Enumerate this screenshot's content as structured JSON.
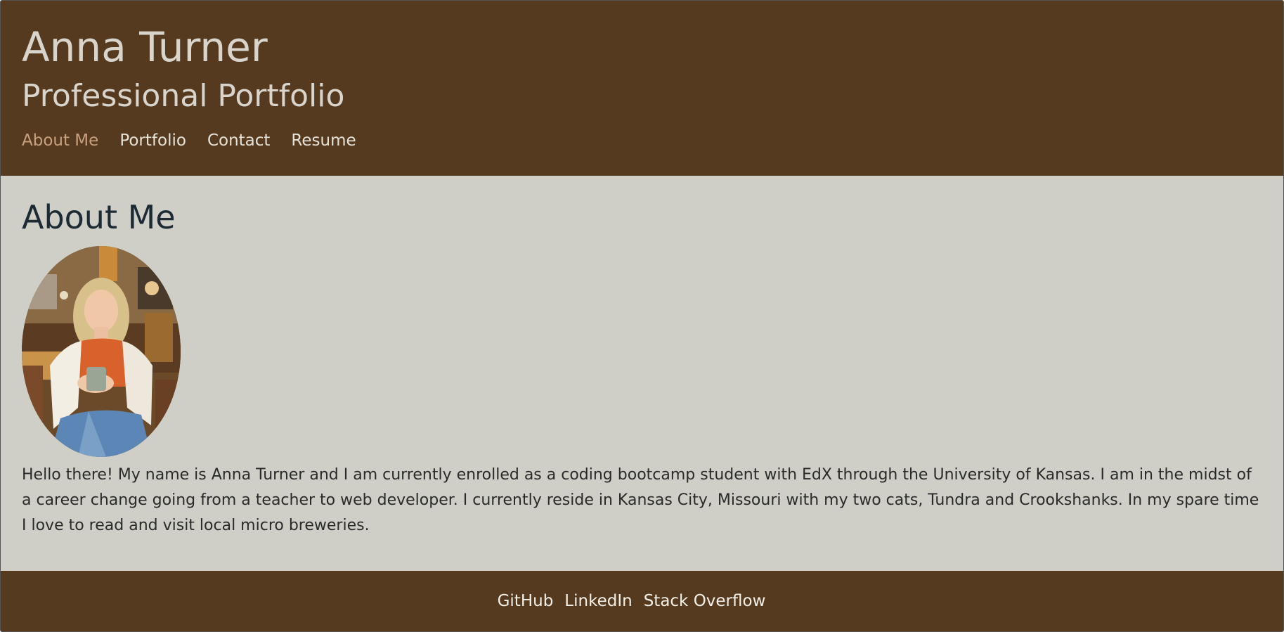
{
  "header": {
    "title": "Anna Turner",
    "subtitle": "Professional Portfolio",
    "nav": [
      {
        "label": "About Me",
        "active": true
      },
      {
        "label": "Portfolio",
        "active": false
      },
      {
        "label": "Contact",
        "active": false
      },
      {
        "label": "Resume",
        "active": false
      }
    ]
  },
  "main": {
    "section_title": "About Me",
    "bio": "Hello there! My name is Anna Turner and I am currently enrolled as a coding bootcamp student with EdX through the University of Kansas. I am in the midst of a career change going from a teacher to web developer. I currently reside in Kansas City, Missouri with my two cats, Tundra and Crookshanks. In my spare time I love to read and visit local micro breweries."
  },
  "footer": {
    "links": [
      "GitHub",
      "LinkedIn",
      "Stack Overflow"
    ]
  },
  "colors": {
    "header_bg": "#553a20",
    "page_bg": "#cfcfc7",
    "nav_active": "#c9a07d",
    "nav_text": "#e6e2d8",
    "title_text": "#d9d5cc"
  }
}
